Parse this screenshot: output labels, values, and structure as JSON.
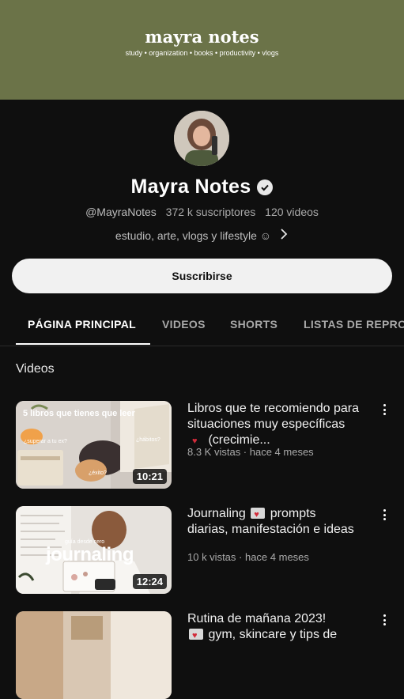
{
  "banner": {
    "title": "mayra notes",
    "subtitle": "study • organization • books • productivity • vlogs",
    "color": "#6b7348"
  },
  "channel": {
    "name": "Mayra Notes",
    "handle": "@MayraNotes",
    "subscribers": "372 k suscriptores",
    "videos_count": "120 videos",
    "description": "estudio, arte, vlogs y lifestyle ☺",
    "verified_icon": "verified-check-icon"
  },
  "subscribe_label": "Suscribirse",
  "tabs": [
    {
      "label": "PÁGINA PRINCIPAL",
      "active": true
    },
    {
      "label": "VIDEOS"
    },
    {
      "label": "SHORTS"
    },
    {
      "label": "LISTAS DE REPRO"
    }
  ],
  "section_title": "Videos",
  "videos": [
    {
      "title": "Libros que te recomiendo para situaciones muy específicas",
      "title_tail": "(crecimie...",
      "meta": "8.3 K vistas · hace 4 meses",
      "duration": "10:21",
      "thumb_text": {
        "top": "5 libros que tienes que leer",
        "a": "¿superar a tu ex?",
        "b": "¿hábitos?",
        "c": "¿éxito?"
      }
    },
    {
      "title_pre": "Journaling",
      "title_post": "prompts diarias, manifestación e ideas",
      "meta": "10 k vistas · hace 4 meses",
      "duration": "12:24",
      "thumb_text": {
        "small": "guía desde cero",
        "big": "journaling"
      }
    },
    {
      "title_line1": "Rutina de mañana 2023!",
      "title_line2": "gym, skincare y tips de"
    }
  ]
}
